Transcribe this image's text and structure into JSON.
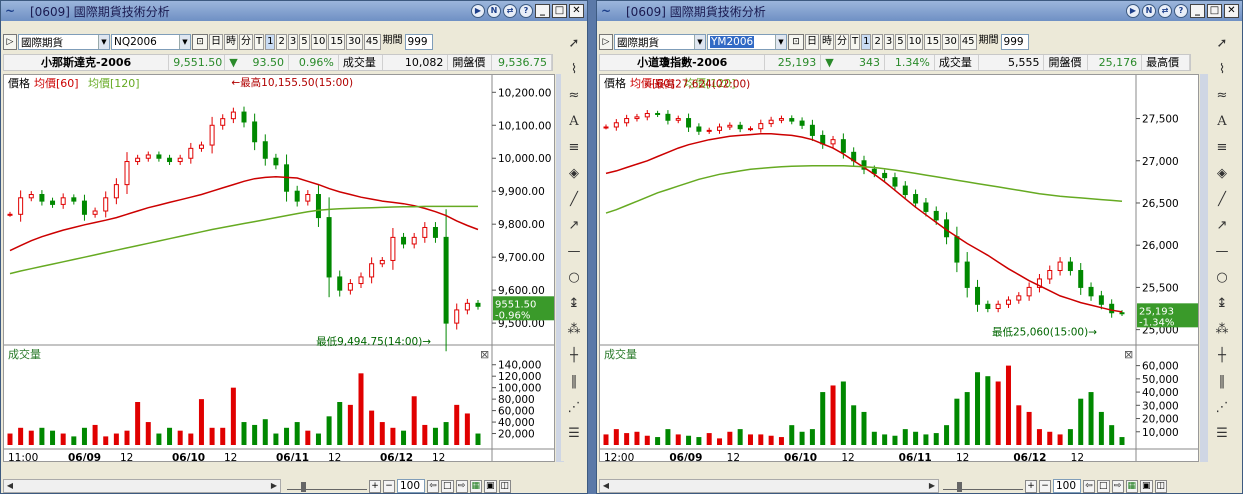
{
  "windows": [
    {
      "title": "[0609] 國際期貨技術分析",
      "toolbar": {
        "market": "國際期貨",
        "symbol": "NQ2006",
        "symbol_selected": false,
        "period_buttons": [
          "日",
          "時",
          "分",
          "T",
          "1",
          "2",
          "3",
          "5",
          "10",
          "15",
          "30",
          "45"
        ],
        "period_label": "期間",
        "period_value": "999"
      },
      "info": {
        "name": "小那斯達克-2006",
        "price": "9,551.50",
        "arrow": "▼",
        "change": "93.50",
        "pct": "0.96%",
        "vol_label": "成交量",
        "vol": "10,082",
        "open_label": "開盤價",
        "open": "9,536.75"
      },
      "legend": {
        "price": "價格",
        "ma60": "均價[60]",
        "ma120": "均價[120]"
      },
      "price_axis": [
        "10,200.00",
        "10,100.00",
        "10,000.00",
        "9,900.00",
        "9,800.00",
        "9,700.00",
        "9,600.00",
        "9,500.00"
      ],
      "axis_min": 9470,
      "axis_max": 10210,
      "high_label": "最高10,155.50(15:00)",
      "low_label": "最低9,494.75(14:00)",
      "last_tag": {
        "price": "9551.50",
        "pct": "-0.96%"
      },
      "vol_title": "成交量",
      "vol_axis": [
        "140,000",
        "120,000",
        "100,000",
        "80,000",
        "60,000",
        "40,000",
        "20,000"
      ],
      "vol_max": 150000,
      "x_labels": [
        "11:00",
        "06/09",
        "12",
        "06/10",
        "12",
        "06/11",
        "12",
        "06/12",
        "12"
      ],
      "zoom": "100",
      "colors": {
        "up": "#e00000",
        "down": "#008800",
        "ma60": "#cc0000",
        "ma120": "#66aa22",
        "tag": "#3a9a2a"
      }
    },
    {
      "title": "[0609] 國際期貨技術分析",
      "toolbar": {
        "market": "國際期貨",
        "symbol": "YM2006",
        "symbol_selected": true,
        "period_buttons": [
          "日",
          "時",
          "分",
          "T",
          "1",
          "2",
          "3",
          "5",
          "10",
          "15",
          "30",
          "45"
        ],
        "period_label": "期間",
        "period_value": "999"
      },
      "info": {
        "name": "小道瓊指數-2006",
        "price": "25,193",
        "arrow": "▼",
        "change": "343",
        "pct": "1.34%",
        "vol_label": "成交量",
        "vol": "5,555",
        "open_label": "開盤價",
        "open": "25,176",
        "high_label": "最高價"
      },
      "legend": {
        "price": "價格",
        "ma60": "均價[60]",
        "ma120": "均價[120]"
      },
      "price_axis": [
        "27,500",
        "27,000",
        "26,500",
        "26,000",
        "25,500",
        "25,000"
      ],
      "axis_min": 24960,
      "axis_max": 27850,
      "high_label": "最高27,624(02:00)",
      "low_label": "最低25,060(15:00)",
      "last_tag": {
        "price": "25,193",
        "pct": "-1.34%"
      },
      "vol_title": "成交量",
      "vol_axis": [
        "60,000",
        "50,000",
        "40,000",
        "30,000",
        "20,000",
        "10,000"
      ],
      "vol_max": 65000,
      "x_labels": [
        "12:00",
        "06/09",
        "12",
        "06/10",
        "12",
        "06/11",
        "12",
        "06/12",
        "12"
      ],
      "zoom": "100",
      "colors": {
        "up": "#e00000",
        "down": "#008800",
        "ma60": "#cc0000",
        "ma120": "#66aa22",
        "tag": "#3a9a2a"
      }
    }
  ],
  "chart_data": [
    {
      "type": "line",
      "title": "小那斯達克-2006",
      "series": [
        {
          "name": "價格",
          "values": [
            9830,
            9880,
            9890,
            9870,
            9860,
            9880,
            9870,
            9830,
            9840,
            9880,
            9920,
            9990,
            10000,
            10010,
            10000,
            9990,
            10000,
            10030,
            10040,
            10100,
            10120,
            10140,
            10110,
            10050,
            10000,
            9980,
            9900,
            9870,
            9890,
            9820,
            9640,
            9600,
            9620,
            9640,
            9680,
            9690,
            9760,
            9740,
            9760,
            9790,
            9760,
            9500,
            9540,
            9560,
            9551
          ]
        },
        {
          "name": "均價[60]",
          "values": [
            9720,
            9735,
            9750,
            9762,
            9772,
            9782,
            9790,
            9798,
            9805,
            9812,
            9820,
            9830,
            9840,
            9850,
            9858,
            9866,
            9874,
            9882,
            9890,
            9900,
            9910,
            9920,
            9930,
            9938,
            9942,
            9944,
            9942,
            9940,
            9930,
            9920,
            9908,
            9898,
            9890,
            9882,
            9876,
            9870,
            9866,
            9862,
            9856,
            9848,
            9838,
            9826,
            9810,
            9796,
            9784
          ]
        },
        {
          "name": "均價[120]",
          "values": [
            9650,
            9658,
            9665,
            9672,
            9679,
            9686,
            9693,
            9700,
            9707,
            9714,
            9721,
            9728,
            9735,
            9742,
            9749,
            9756,
            9763,
            9770,
            9777,
            9784,
            9790,
            9796,
            9802,
            9808,
            9814,
            9820,
            9826,
            9832,
            9838,
            9842,
            9845,
            9847,
            9848,
            9849,
            9850,
            9851,
            9852,
            9853,
            9853,
            9854,
            9854,
            9854,
            9854,
            9854,
            9854
          ]
        }
      ],
      "volume": [
        20000,
        30000,
        25000,
        30000,
        25000,
        20000,
        15000,
        30000,
        35000,
        15000,
        20000,
        25000,
        75000,
        40000,
        20000,
        30000,
        25000,
        20000,
        80000,
        30000,
        30000,
        100000,
        40000,
        35000,
        45000,
        20000,
        30000,
        40000,
        25000,
        20000,
        50000,
        75000,
        70000,
        125000,
        60000,
        40000,
        30000,
        25000,
        85000,
        35000,
        30000,
        40000,
        70000,
        55000,
        20000
      ],
      "xlabel": "",
      "ylabel": "",
      "ylim": [
        9470,
        10210
      ]
    },
    {
      "type": "line",
      "title": "小道瓊指數-2006",
      "series": [
        {
          "name": "價格",
          "values": [
            27400,
            27450,
            27500,
            27520,
            27560,
            27550,
            27480,
            27500,
            27400,
            27350,
            27360,
            27400,
            27420,
            27380,
            27380,
            27440,
            27480,
            27500,
            27470,
            27420,
            27300,
            27200,
            27250,
            27100,
            27000,
            26900,
            26850,
            26800,
            26700,
            26600,
            26500,
            26400,
            26300,
            26100,
            25800,
            25500,
            25300,
            25250,
            25300,
            25350,
            25400,
            25500,
            25600,
            25700,
            25800,
            25700,
            25500,
            25400,
            25300,
            25200,
            25193
          ]
        },
        {
          "name": "均價[60]",
          "values": [
            26850,
            26880,
            26920,
            26960,
            27000,
            27050,
            27100,
            27150,
            27190,
            27220,
            27250,
            27270,
            27290,
            27300,
            27310,
            27320,
            27320,
            27310,
            27300,
            27280,
            27250,
            27200,
            27150,
            27080,
            27000,
            26920,
            26840,
            26750,
            26650,
            26550,
            26450,
            26360,
            26270,
            26180,
            26100,
            26020,
            25950,
            25880,
            25800,
            25720,
            25650,
            25580,
            25520,
            25460,
            25400,
            25360,
            25320,
            25290,
            25260,
            25230,
            25210
          ]
        },
        {
          "name": "均價[120]",
          "values": [
            26380,
            26420,
            26470,
            26520,
            26570,
            26620,
            26660,
            26700,
            26740,
            26780,
            26810,
            26840,
            26860,
            26880,
            26900,
            26910,
            26920,
            26930,
            26935,
            26938,
            26940,
            26941,
            26942,
            26940,
            26936,
            26930,
            26920,
            26905,
            26890,
            26870,
            26850,
            26830,
            26810,
            26790,
            26770,
            26750,
            26730,
            26710,
            26690,
            26670,
            26650,
            26630,
            26610,
            26595,
            26580,
            26570,
            26560,
            26550,
            26540,
            26530,
            26520
          ]
        }
      ],
      "volume": [
        8000,
        12000,
        9000,
        10000,
        7000,
        6000,
        12000,
        8000,
        7000,
        6000,
        9000,
        5000,
        10000,
        12000,
        8000,
        8000,
        7000,
        6000,
        15000,
        10000,
        12000,
        40000,
        45000,
        48000,
        30000,
        25000,
        10000,
        8000,
        7000,
        12000,
        10000,
        8000,
        9000,
        15000,
        35000,
        40000,
        55000,
        52000,
        48000,
        60000,
        30000,
        25000,
        12000,
        10000,
        8000,
        12000,
        35000,
        40000,
        25000,
        15000,
        6000
      ],
      "xlabel": "",
      "ylabel": "",
      "ylim": [
        24960,
        27850
      ]
    }
  ]
}
